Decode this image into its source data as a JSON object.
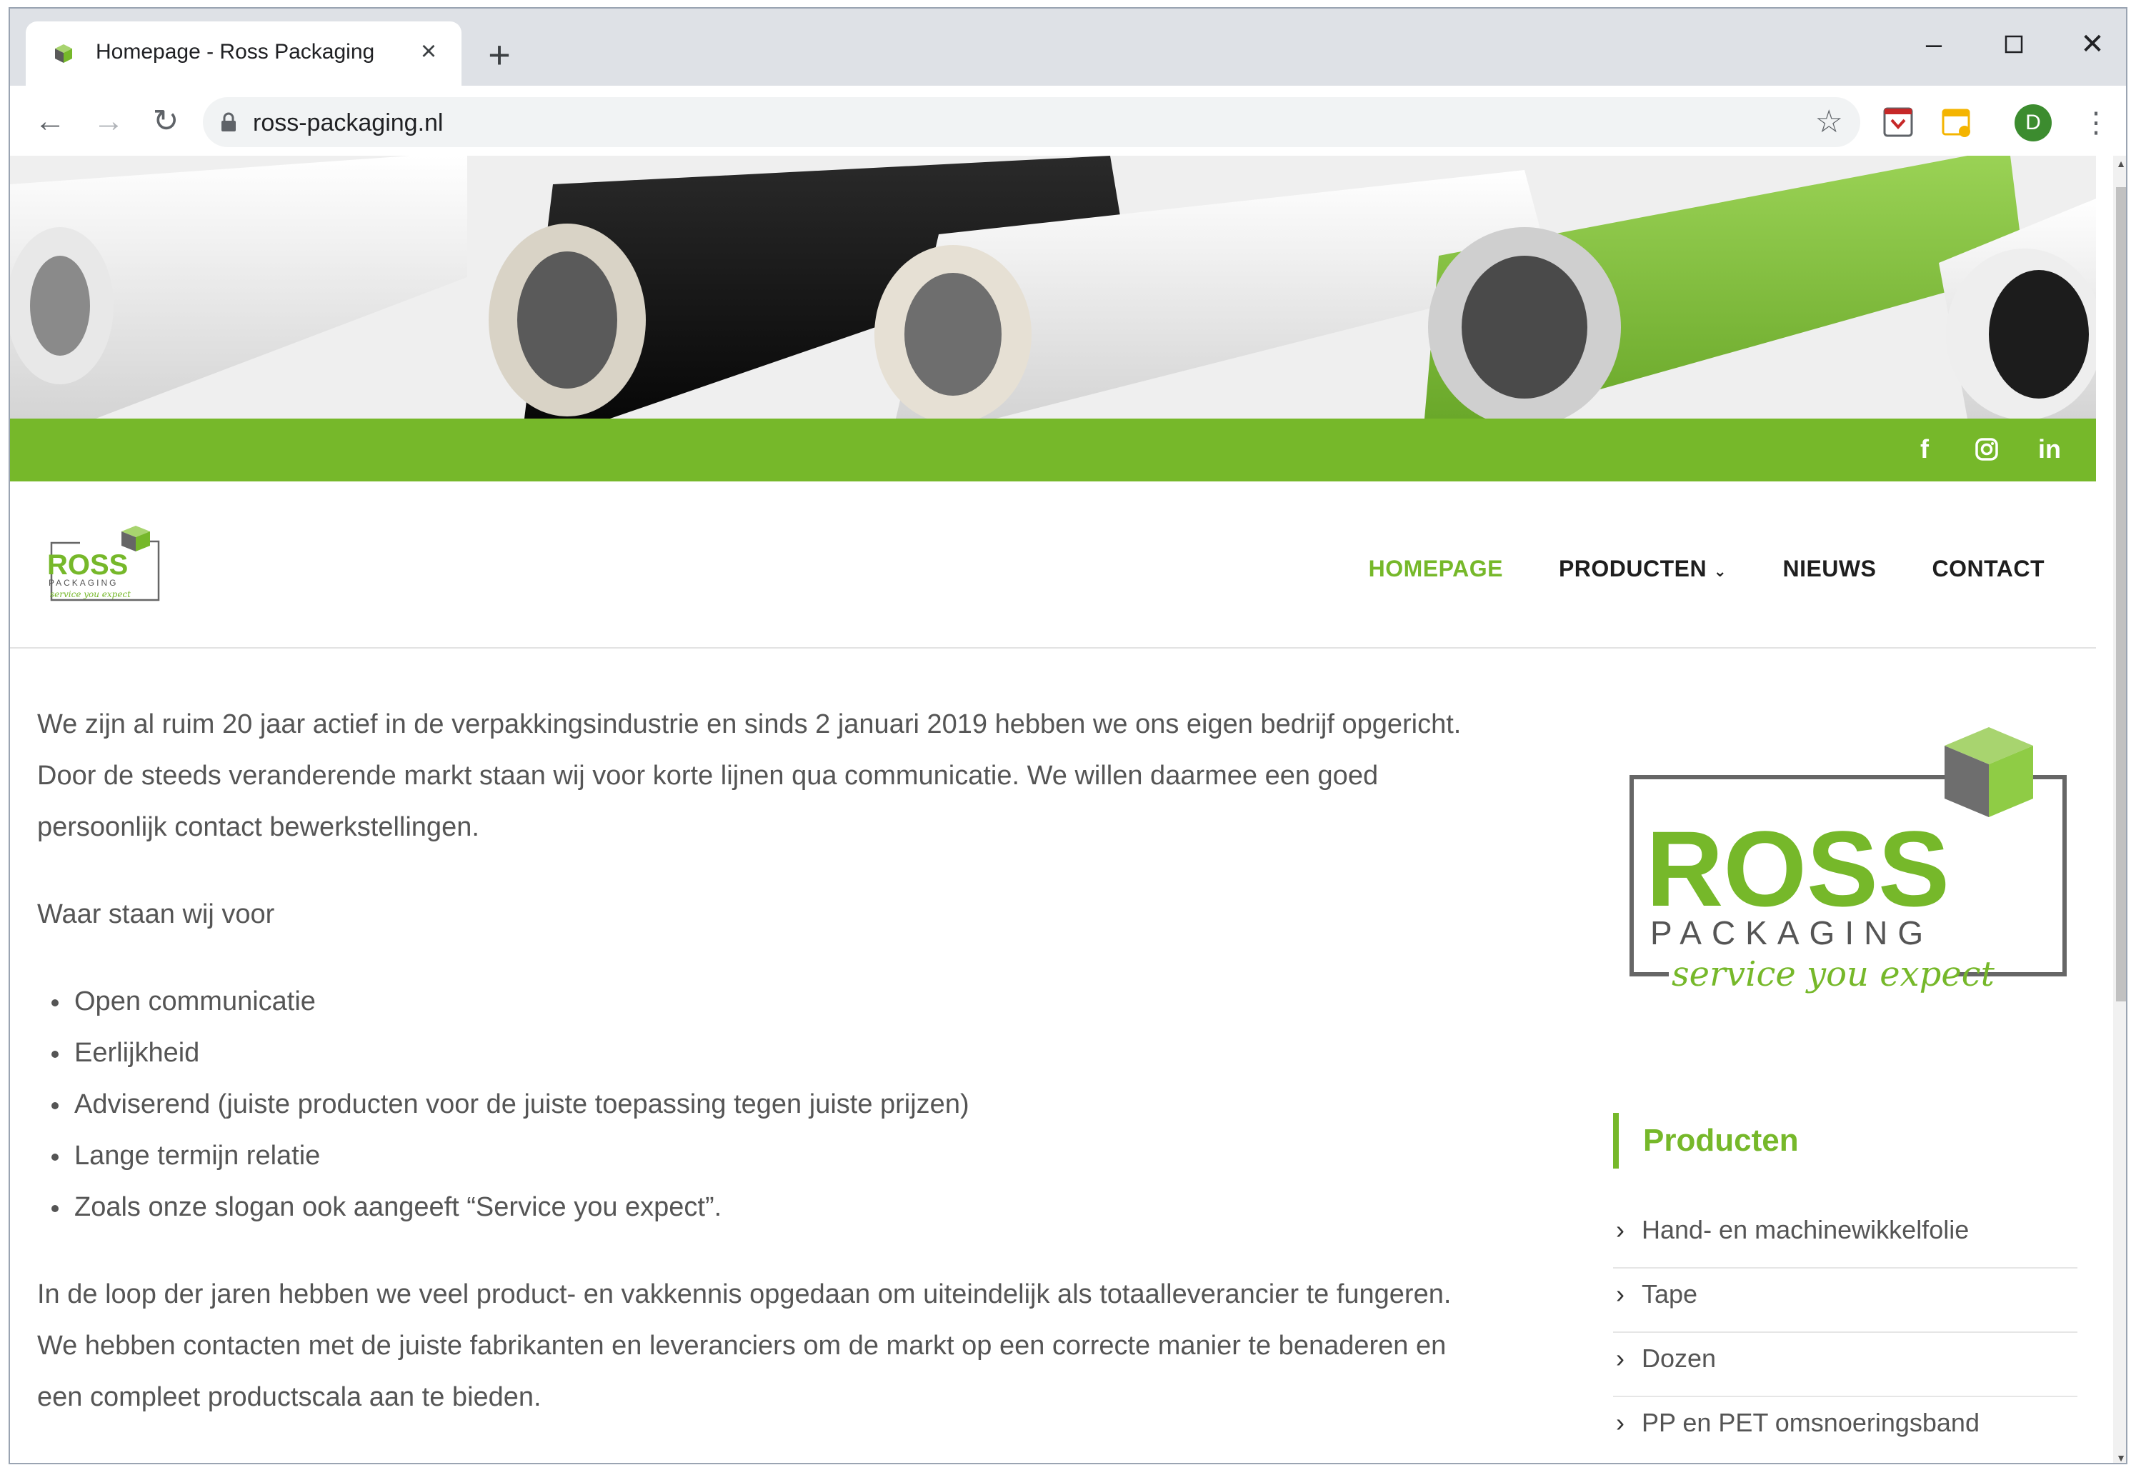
{
  "browser": {
    "tab_title": "Homepage - Ross Packaging",
    "url": "ross-packaging.nl",
    "profile_initial": "D",
    "icons": {
      "back": "arrow-left-icon",
      "forward": "arrow-right-icon",
      "reload": "reload-icon",
      "close_tab": "close-icon",
      "new_tab": "plus-icon",
      "bookmark": "star-icon",
      "menu": "more-vert-icon"
    }
  },
  "site": {
    "brand_color": "#76b82a",
    "social": [
      "f",
      "instagram",
      "in"
    ],
    "nav": [
      {
        "label": "HOMEPAGE",
        "active": true
      },
      {
        "label": "PRODUCTEN",
        "has_dropdown": true
      },
      {
        "label": "NIEUWS"
      },
      {
        "label": "CONTACT"
      }
    ],
    "logo": {
      "wordmark": "ROSS",
      "sub": "PACKAGING",
      "slogan": "service you expect"
    }
  },
  "content": {
    "intro": "We zijn al ruim 20 jaar actief in de verpakkingsindustrie en sinds 2 januari 2019 hebben we ons eigen bedrijf opgericht. Door de steeds veranderende markt staan wij voor korte lijnen qua communicatie. We willen daarmee een goed persoonlijk contact bewerkstellingen.",
    "values_heading": "Waar staan wij voor",
    "values": [
      "Open communicatie",
      "Eerlijkheid",
      "Adviserend (juiste producten voor de juiste toepassing tegen juiste prijzen)",
      "Lange termijn relatie",
      "Zoals onze slogan ook aangeeft “Service you expect”."
    ],
    "outro": "In de loop der jaren hebben we veel product- en vakkennis opgedaan om uiteindelijk als totaalleverancier te fungeren. We hebben contacten met de juiste fabrikanten en leveranciers om de markt op een correcte manier te benaderen en een compleet productscala aan te bieden."
  },
  "sidebar": {
    "heading": "Producten",
    "items": [
      "Hand- en machinewikkelfolie",
      "Tape",
      "Dozen",
      "PP en PET omsnoeringsband"
    ]
  }
}
